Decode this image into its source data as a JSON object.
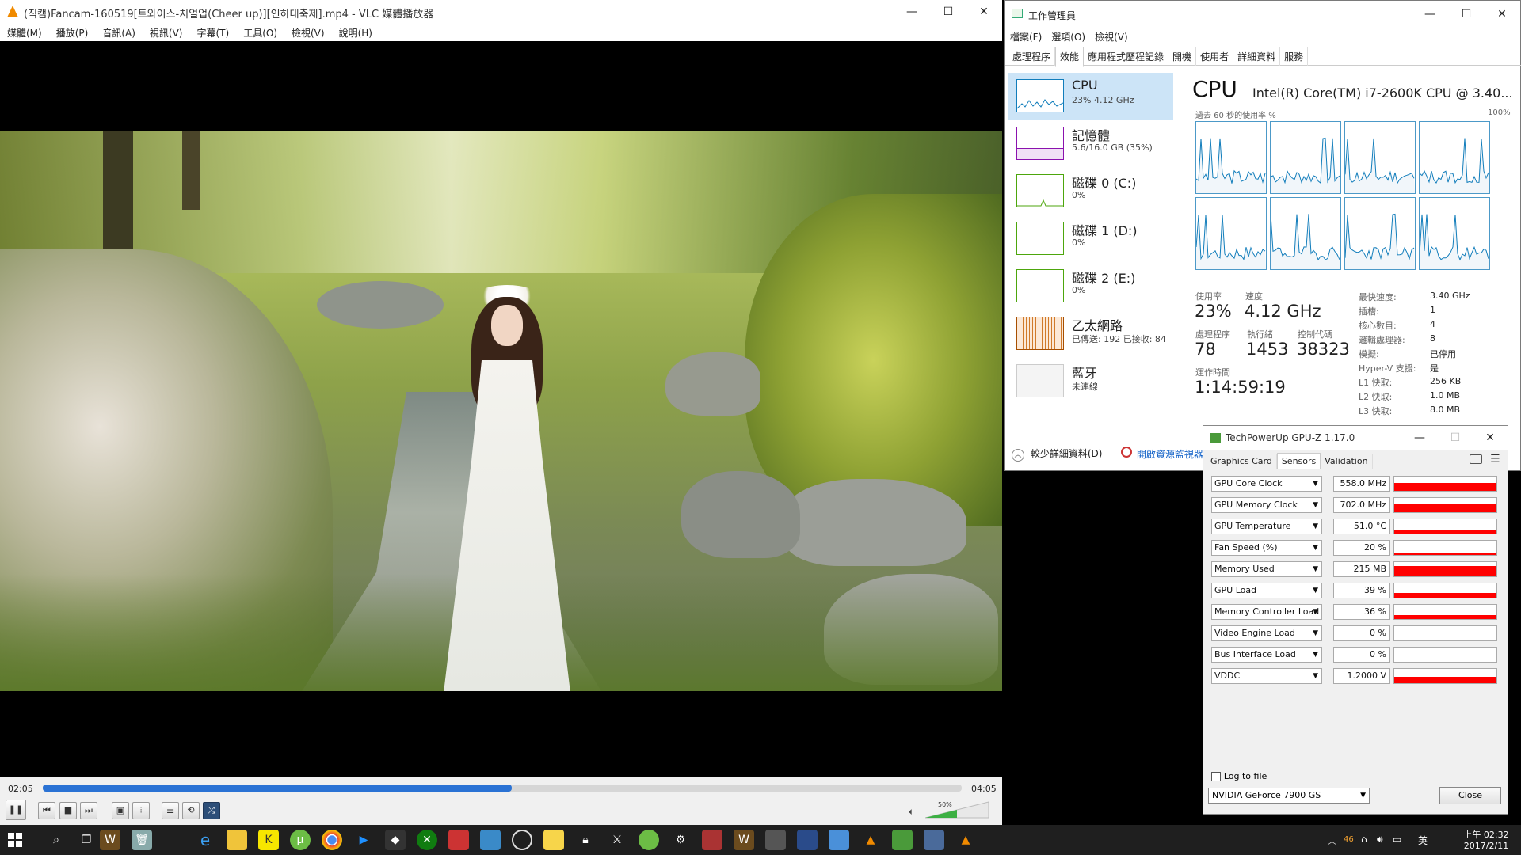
{
  "vlc": {
    "title": "(직캠)Fancam-160519[트와이스-치얼업(Cheer up)][인하대축제].mp4 - VLC 媒體播放器",
    "menu": [
      "媒體(M)",
      "播放(P)",
      "音訊(A)",
      "視訊(V)",
      "字幕(T)",
      "工具(O)",
      "檢視(V)",
      "說明(H)"
    ],
    "time_elapsed": "02:05",
    "time_total": "04:05",
    "progress": 0.51,
    "volume_label": "50%",
    "volume": 0.5
  },
  "taskmgr": {
    "title": "工作管理員",
    "menu": [
      "檔案(F)",
      "選項(O)",
      "檢視(V)"
    ],
    "tabs": [
      "處理程序",
      "效能",
      "應用程式歷程記錄",
      "開機",
      "使用者",
      "詳細資料",
      "服務"
    ],
    "selected_tab": 1,
    "sidebar": [
      {
        "name": "CPU",
        "sub": "23% 4.12 GHz",
        "color": "#117dbb"
      },
      {
        "name": "記憶體",
        "sub": "5.6/16.0 GB (35%)",
        "color": "#8b12ae"
      },
      {
        "name": "磁碟 0 (C:)",
        "sub": "0%",
        "color": "#4da60c"
      },
      {
        "name": "磁碟 1 (D:)",
        "sub": "0%",
        "color": "#4da60c"
      },
      {
        "name": "磁碟 2 (E:)",
        "sub": "0%",
        "color": "#4da60c"
      },
      {
        "name": "乙太網路",
        "sub": "已傳送: 192 已接收: 84",
        "color": "#a74f01"
      },
      {
        "name": "藍牙",
        "sub": "未連線",
        "color": "#999999"
      }
    ],
    "cpu": {
      "heading": "CPU",
      "model": "Intel(R) Core(TM) i7-2600K CPU @ 3.40...",
      "graph_caption": "過去 60 秒的使用率 %",
      "graph_max": "100%",
      "stats": [
        {
          "label": "使用率",
          "value": "23%"
        },
        {
          "label": "速度",
          "value": "4.12 GHz"
        },
        {
          "label": "處理程序",
          "value": "78"
        },
        {
          "label": "執行緒",
          "value": "1453"
        },
        {
          "label": "控制代碼",
          "value": "38323"
        },
        {
          "label": "運作時間",
          "value": "1:14:59:19"
        }
      ],
      "details": [
        {
          "k": "最快速度:",
          "v": "3.40 GHz"
        },
        {
          "k": "插槽:",
          "v": "1"
        },
        {
          "k": "核心數目:",
          "v": "4"
        },
        {
          "k": "邏輯處理器:",
          "v": "8"
        },
        {
          "k": "模擬:",
          "v": "已停用"
        },
        {
          "k": "Hyper-V 支援:",
          "v": "是"
        },
        {
          "k": "L1 快取:",
          "v": "256 KB"
        },
        {
          "k": "L2 快取:",
          "v": "1.0 MB"
        },
        {
          "k": "L3 快取:",
          "v": "8.0 MB"
        }
      ]
    },
    "fewer_details": "較少詳細資料(D)",
    "open_resmon": "開啟資源監視器"
  },
  "gpuz": {
    "title": "TechPowerUp GPU-Z 1.17.0",
    "tabs": [
      "Graphics Card",
      "Sensors",
      "Validation"
    ],
    "selected_tab": 1,
    "sensors": [
      {
        "name": "GPU Core Clock",
        "value": "558.0 MHz",
        "level": 0.55
      },
      {
        "name": "GPU Memory Clock",
        "value": "702.0 MHz",
        "level": 0.55
      },
      {
        "name": "GPU Temperature",
        "value": "51.0 °C",
        "level": 0.3
      },
      {
        "name": "Fan Speed (%)",
        "value": "20 %",
        "level": 0.15
      },
      {
        "name": "Memory Used",
        "value": "215 MB",
        "level": 0.7
      },
      {
        "name": "GPU Load",
        "value": "39 %",
        "level": 0.35
      },
      {
        "name": "Memory Controller Load",
        "value": "36 %",
        "level": 0.3
      },
      {
        "name": "Video Engine Load",
        "value": "0 %",
        "level": 0
      },
      {
        "name": "Bus Interface Load",
        "value": "0 %",
        "level": 0
      },
      {
        "name": "VDDC",
        "value": "1.2000 V",
        "level": 0.45
      }
    ],
    "log_to_file": "Log to file",
    "gpu_select": "NVIDIA GeForce 7900 GS",
    "close": "Close"
  },
  "taskbar": {
    "time": "上午 02:32",
    "date": "2017/2/11",
    "ime": "英",
    "tray_count": "46"
  }
}
